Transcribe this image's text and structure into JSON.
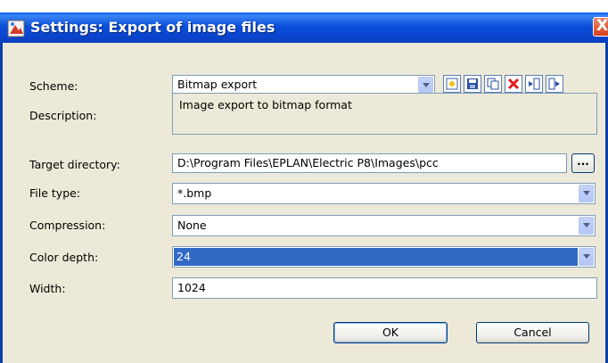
{
  "window": {
    "title": "Settings: Export of image files",
    "close_glyph": "X"
  },
  "form": {
    "scheme": {
      "label": "Scheme:",
      "value": "Bitmap export"
    },
    "description": {
      "label": "Description:",
      "value": "Image export to bitmap format"
    },
    "target_directory": {
      "label": "Target directory:",
      "value": "D:\\Program Files\\EPLAN\\Electric P8\\Images\\pcc",
      "browse_label": "..."
    },
    "file_type": {
      "label": "File type:",
      "value": "*.bmp"
    },
    "compression": {
      "label": "Compression:",
      "value": "None"
    },
    "color_depth": {
      "label": "Color depth:",
      "value": "24"
    },
    "width": {
      "label": "Width:",
      "value": "1024"
    }
  },
  "toolbar": {
    "icons": [
      "new-icon",
      "save-icon",
      "copy-icon",
      "delete-icon",
      "import-icon",
      "export-icon"
    ]
  },
  "buttons": {
    "ok_label": "OK",
    "cancel_label": "Cancel"
  },
  "colors": {
    "titlebar": "#0a4fd9",
    "dialog_bg": "#ece9d8",
    "selection": "#316ac5",
    "delete_red": "#e21b1b"
  }
}
